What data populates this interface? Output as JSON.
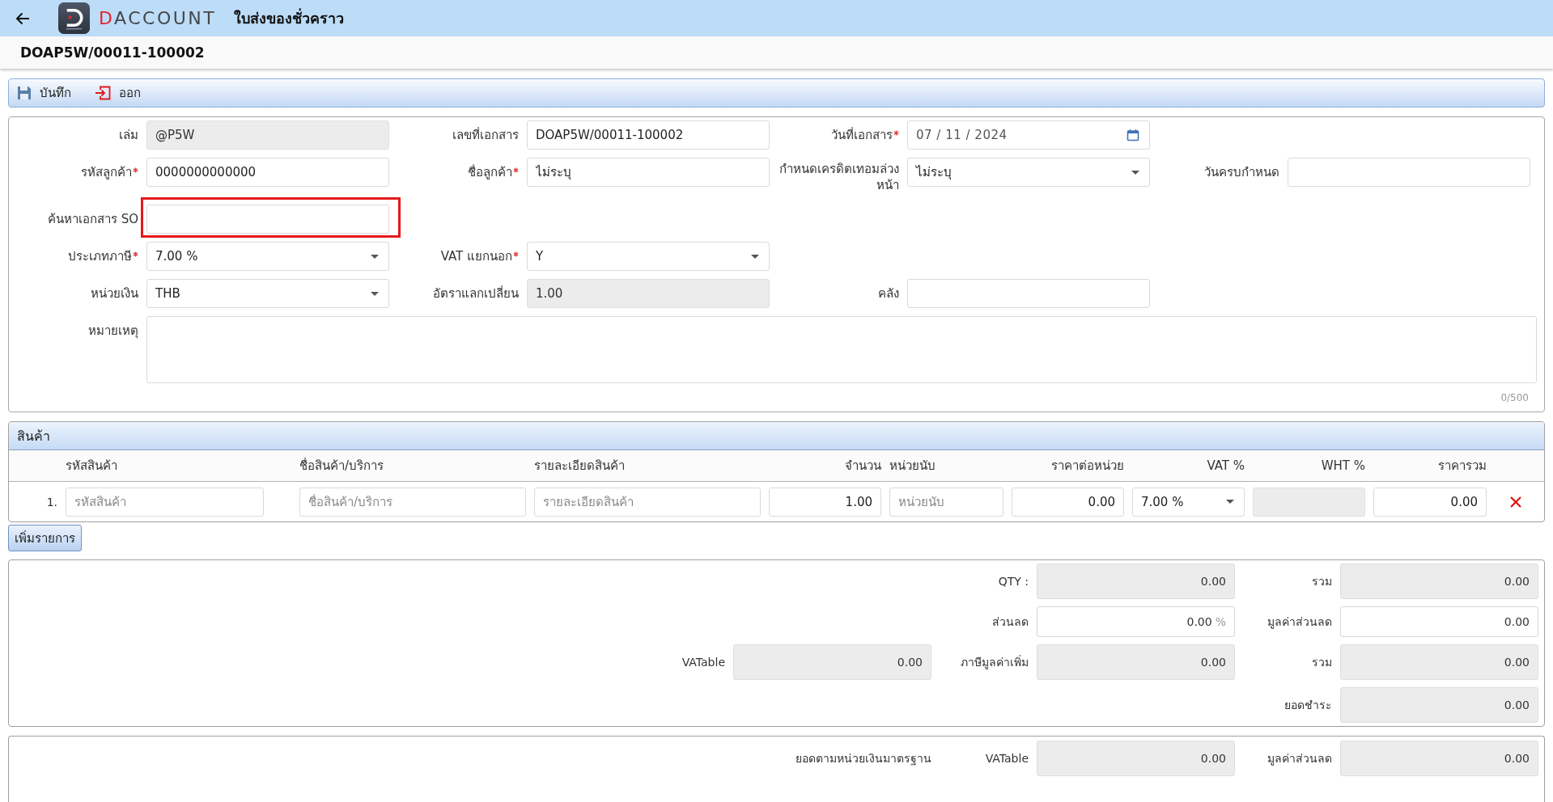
{
  "app_bar": {
    "brand": "DACCOUNT",
    "title": "ใบส่งของชั่วคราว"
  },
  "document_bar": {
    "number": "DOAP5W/00011-100002"
  },
  "toolbar": {
    "buttons": [
      {
        "kind": "save",
        "label": "บันทึก"
      },
      {
        "kind": "exit",
        "label": "ออก"
      }
    ]
  },
  "form": {
    "rows": [
      {
        "fields": [
          {
            "label": "เล่ม",
            "kind": "text",
            "value": "@P5W",
            "required": false,
            "disabled": true,
            "highlighted": false
          },
          {
            "label": "เลขที่เอกสาร",
            "kind": "text",
            "value": "DOAP5W/00011-100002",
            "required": false,
            "disabled": false,
            "highlighted": false
          },
          {
            "label": "วันที่เอกสาร",
            "kind": "date",
            "value": "07 / 11 / 2024",
            "required": true,
            "disabled": false,
            "highlighted": false
          }
        ]
      },
      {
        "fields": [
          {
            "label": "รหัสลูกค้า",
            "kind": "text",
            "value": "0000000000000",
            "required": true,
            "disabled": false,
            "highlighted": false
          },
          {
            "label": "ชื่อลูกค้า",
            "kind": "text",
            "value": "ไม่ระบุ",
            "required": true,
            "disabled": false,
            "highlighted": false
          },
          {
            "label": "กำหนดเครดิตเทอมล่วงหน้า",
            "kind": "select",
            "value": "ไม่ระบุ",
            "required": false,
            "disabled": false,
            "highlighted": false
          },
          {
            "label": "วันครบกำหนด",
            "kind": "text",
            "required": false,
            "disabled": false,
            "highlighted": false
          }
        ]
      },
      {
        "fields": [
          {
            "label": "ค้นหาเอกสาร SO",
            "kind": "text",
            "required": false,
            "disabled": false,
            "highlighted": true
          }
        ]
      },
      {
        "fields": [
          {
            "label": "ประเภทภาษี",
            "kind": "select",
            "value": "7.00 %",
            "required": true,
            "disabled": false,
            "highlighted": false
          },
          {
            "label": "VAT แยกนอก",
            "kind": "select",
            "value": "Y",
            "required": true,
            "disabled": false,
            "highlighted": false
          }
        ]
      },
      {
        "fields": [
          {
            "label": "หน่วยเงิน",
            "kind": "select",
            "value": "THB",
            "required": false,
            "disabled": false,
            "highlighted": false
          },
          {
            "label": "อัตราแลกเปลี่ยน",
            "kind": "text",
            "value": "1.00",
            "required": false,
            "disabled": true,
            "highlighted": false
          },
          {
            "label": "คลัง",
            "kind": "text",
            "required": false,
            "disabled": false,
            "highlighted": false
          }
        ]
      }
    ],
    "remark": {
      "label": "หมายเหตุ",
      "counter": "0/500"
    }
  },
  "products": {
    "title": "สินค้า",
    "columns": [
      {
        "label": "รหัสสินค้า",
        "kind": "text"
      },
      {
        "label": "ชื่อสินค้า/บริการ",
        "kind": "text"
      },
      {
        "label": "รายละเอียดสินค้า",
        "kind": "text"
      },
      {
        "label": "จำนวน",
        "kind": "number"
      },
      {
        "label": "หน่วยนับ",
        "kind": "text"
      },
      {
        "label": "ราคาต่อหน่วย",
        "kind": "number"
      },
      {
        "label": "VAT %",
        "kind": "select"
      },
      {
        "label": "WHT %",
        "kind": "number"
      },
      {
        "label": "ราคารวม",
        "kind": "number"
      }
    ],
    "rows": [
      {
        "number": "1.",
        "cells": [
          {
            "placeholder": "รหัสสินค้า",
            "disabled": false
          },
          {
            "placeholder": "ชื่อสินค้า/บริการ",
            "disabled": false
          },
          {
            "placeholder": "รายละเอียดสินค้า",
            "disabled": false
          },
          {
            "value": "1.00",
            "disabled": false
          },
          {
            "placeholder": "หน่วยนับ",
            "disabled": false
          },
          {
            "value": "0.00",
            "disabled": false
          },
          {
            "value": "7.00 %",
            "disabled": false
          },
          {
            "disabled": true
          },
          {
            "value": "0.00",
            "disabled": false
          }
        ]
      }
    ],
    "add_button": "เพิ่มรายการ"
  },
  "totals": {
    "rows": [
      {
        "items": [
          {
            "label": "QTY :",
            "value": "0.00",
            "disabled": true
          },
          {
            "label": "รวม",
            "value": "0.00",
            "disabled": true
          }
        ]
      },
      {
        "items": [
          {
            "label": "ส่วนลด",
            "value": "0.00",
            "unit": "%",
            "disabled": false
          },
          {
            "label": "มูลค่าส่วนลด",
            "value": "0.00",
            "disabled": false
          }
        ]
      },
      {
        "items": [
          {
            "label": "VATable",
            "value": "0.00",
            "disabled": true
          },
          {
            "label": "ภาษีมูลค่าเพิ่ม",
            "value": "0.00",
            "disabled": true
          },
          {
            "label": "รวม",
            "value": "0.00",
            "disabled": true
          }
        ]
      },
      {
        "items": [
          {
            "label": "ยอดชำระ",
            "value": "0.00",
            "disabled": true
          }
        ]
      }
    ]
  },
  "base_currency_totals": {
    "caption": "ยอดตามหน่วยเงินมาตรฐาน",
    "rows": [
      {
        "items": [
          {
            "label": "VATable",
            "value": "0.00",
            "disabled": true
          },
          {
            "label": "มูลค่าส่วนลด",
            "value": "0.00",
            "disabled": true
          }
        ]
      }
    ]
  }
}
